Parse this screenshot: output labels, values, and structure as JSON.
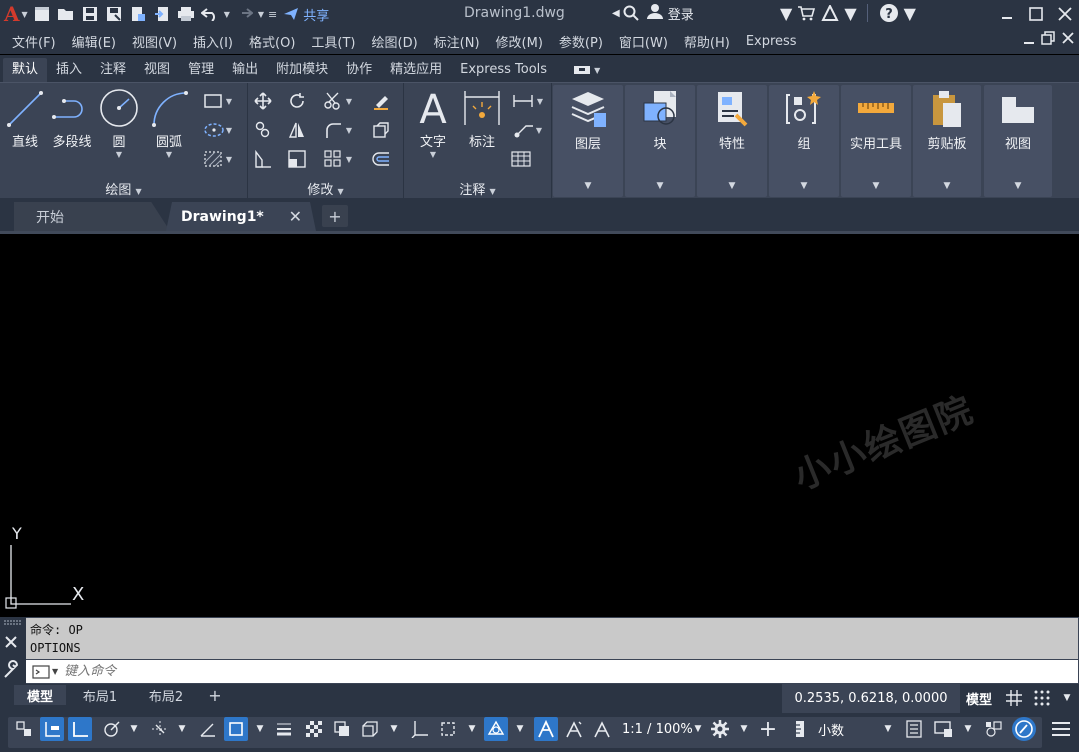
{
  "titlebar": {
    "share_label": "共享",
    "doc_title": "Drawing1.dwg",
    "login_label": "登录"
  },
  "menu": [
    "文件(F)",
    "编辑(E)",
    "视图(V)",
    "插入(I)",
    "格式(O)",
    "工具(T)",
    "绘图(D)",
    "标注(N)",
    "修改(M)",
    "参数(P)",
    "窗口(W)",
    "帮助(H)",
    "Express"
  ],
  "ribbon_tabs": [
    "默认",
    "插入",
    "注释",
    "视图",
    "管理",
    "输出",
    "附加模块",
    "协作",
    "精选应用",
    "Express Tools"
  ],
  "ribbon": {
    "draw": {
      "title": "绘图",
      "line": "直线",
      "polyline": "多段线",
      "circle": "圆",
      "arc": "圆弧"
    },
    "modify": {
      "title": "修改"
    },
    "annotation": {
      "title": "注释",
      "text": "文字",
      "dimension": "标注"
    },
    "layers": "图层",
    "block": "块",
    "properties": "特性",
    "group": "组",
    "utilities": "实用工具",
    "clipboard": "剪贴板",
    "view": "视图"
  },
  "file_tabs": {
    "start": "开始",
    "drawing": "Drawing1*"
  },
  "canvas": {
    "ucs_x": "X",
    "ucs_y": "Y",
    "watermark": "小小绘图院"
  },
  "command": {
    "history": [
      "命令: OP",
      "OPTIONS"
    ],
    "placeholder": "键入命令"
  },
  "layout_tabs": [
    "模型",
    "布局1",
    "布局2"
  ],
  "statusbar": {
    "coordinates": "0.2535, 0.6218, 0.0000",
    "model_label": "模型",
    "scale": "1:1 / 100%",
    "units": "小数"
  },
  "colors": {
    "accent": "#2e77c9",
    "panel": "#3b4455",
    "dark": "#2b3443"
  }
}
